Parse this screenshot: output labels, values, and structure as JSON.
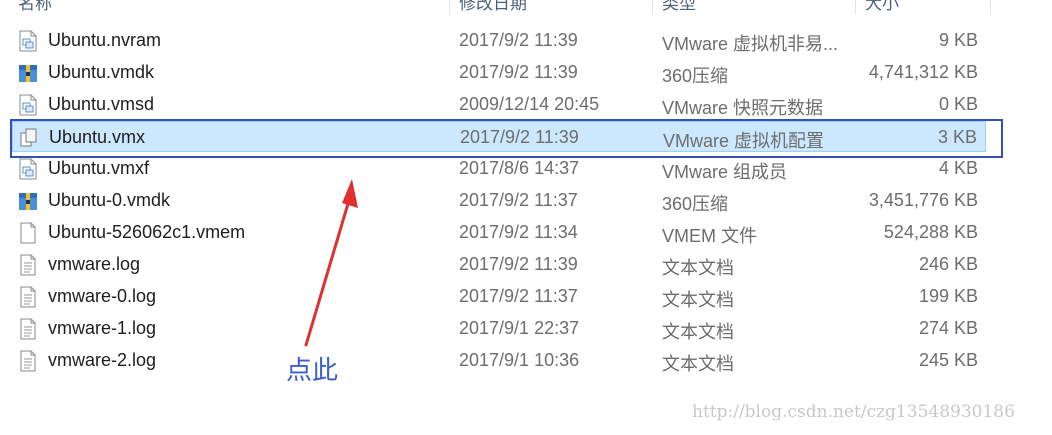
{
  "header": {
    "name": "名称",
    "date": "修改日期",
    "type": "类型",
    "size": "大小"
  },
  "files": [
    {
      "name": "Ubuntu.nvram",
      "date": "2017/9/2 11:39",
      "type": "VMware 虚拟机非易...",
      "size": "9 KB",
      "icon": "vmware-file-icon"
    },
    {
      "name": "Ubuntu.vmdk",
      "date": "2017/9/2 11:39",
      "type": "360压缩",
      "size": "4,741,312 KB",
      "icon": "archive-icon"
    },
    {
      "name": "Ubuntu.vmsd",
      "date": "2009/12/14 20:45",
      "type": "VMware 快照元数据",
      "size": "0 KB",
      "icon": "vmware-file-icon"
    },
    {
      "name": "Ubuntu.vmx",
      "date": "2017/9/2 11:39",
      "type": "VMware 虚拟机配置",
      "size": "3 KB",
      "icon": "vmx-config-icon"
    },
    {
      "name": "Ubuntu.vmxf",
      "date": "2017/8/6 14:37",
      "type": "VMware 组成员",
      "size": "4 KB",
      "icon": "vmware-file-icon"
    },
    {
      "name": "Ubuntu-0.vmdk",
      "date": "2017/9/2 11:37",
      "type": "360压缩",
      "size": "3,451,776 KB",
      "icon": "archive-icon"
    },
    {
      "name": "Ubuntu-526062c1.vmem",
      "date": "2017/9/2 11:34",
      "type": "VMEM 文件",
      "size": "524,288 KB",
      "icon": "blank-file-icon"
    },
    {
      "name": "vmware.log",
      "date": "2017/9/2 11:39",
      "type": "文本文档",
      "size": "246 KB",
      "icon": "text-file-icon"
    },
    {
      "name": "vmware-0.log",
      "date": "2017/9/2 11:37",
      "type": "文本文档",
      "size": "199 KB",
      "icon": "text-file-icon"
    },
    {
      "name": "vmware-1.log",
      "date": "2017/9/1 22:37",
      "type": "文本文档",
      "size": "274 KB",
      "icon": "text-file-icon"
    },
    {
      "name": "vmware-2.log",
      "date": "2017/9/1 10:36",
      "type": "文本文档",
      "size": "245 KB",
      "icon": "text-file-icon"
    }
  ],
  "annotation": {
    "label": "点此",
    "color": "#3c5ccf",
    "box_color": "#3550b0",
    "arrow_color": "#e03030"
  },
  "watermark": "http://blog.csdn.net/czg13548930186",
  "colors": {
    "selected_bg": "#cce8ff",
    "selected_border": "#99d1ff"
  }
}
